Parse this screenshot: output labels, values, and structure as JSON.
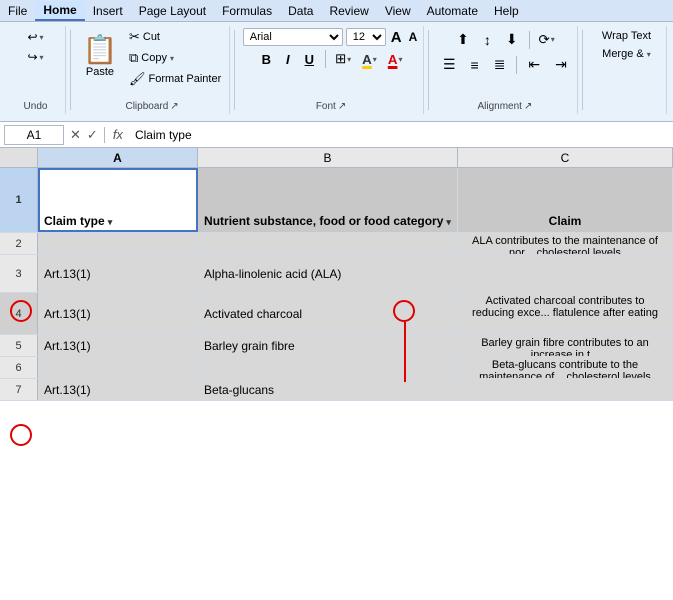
{
  "menubar": {
    "items": [
      "File",
      "Home",
      "Insert",
      "Page Layout",
      "Formulas",
      "Data",
      "Review",
      "View",
      "Automate",
      "Help"
    ]
  },
  "ribbon": {
    "groups": {
      "undo": {
        "label": "Undo",
        "undo_label": "↩",
        "redo_label": "↪"
      },
      "clipboard": {
        "label": "Clipboard",
        "paste_label": "Paste",
        "cut_label": "Cut",
        "copy_label": "Copy",
        "format_painter_label": "Format Painter",
        "expand_icon": "⌄"
      },
      "font": {
        "label": "Font",
        "font_name": "Arial",
        "font_size": "12",
        "bold": "B",
        "italic": "I",
        "underline": "U",
        "borders_label": "⊞",
        "fill_label": "A",
        "font_color_label": "A",
        "increase_size": "A",
        "decrease_size": "A",
        "expand_icon": "⌄"
      },
      "alignment": {
        "label": "Alignment",
        "wrap_text": "Wrap Text",
        "merge_label": "Merge &",
        "align_left": "≡",
        "align_center": "≡",
        "align_right": "≡",
        "align_top": "≡",
        "align_middle": "≡",
        "align_bottom": "≡"
      }
    }
  },
  "formula_bar": {
    "cell_ref": "A1",
    "formula_text": "Claim type",
    "fx": "fx"
  },
  "spreadsheet": {
    "columns": [
      "A",
      "B",
      "C"
    ],
    "header_row": {
      "col_a": "Claim type",
      "col_b": "Nutrient substance, food or food category",
      "col_c": "Claim"
    },
    "rows": [
      {
        "num": "1",
        "a": "Claim type",
        "b": "Nutrient substance, food or food category",
        "c": "Claim",
        "is_header": true
      },
      {
        "num": "2",
        "a": "",
        "b": "",
        "c": "ALA contributes to the maintenance of nor... cholesterol levels",
        "is_header": false
      },
      {
        "num": "3",
        "a": "Art.13(1)",
        "b": "Alpha-linolenic acid (ALA)",
        "c": "",
        "is_header": false
      },
      {
        "num": "4",
        "a": "Art.13(1)",
        "b": "Activated charcoal",
        "c": "Activated charcoal contributes to reducing exce... flatulence after eating",
        "is_header": false
      },
      {
        "num": "5",
        "a": "Art.13(1)",
        "b": "Barley grain fibre",
        "c": "Barley grain fibre contributes to an increase in t...",
        "is_header": false
      },
      {
        "num": "6",
        "a": "",
        "b": "",
        "c": "Beta-glucans contribute to the maintenance of... cholesterol levels",
        "is_header": false
      },
      {
        "num": "7",
        "a": "Art.13(1)",
        "b": "Beta-glucans",
        "c": "",
        "is_header": false
      }
    ]
  }
}
